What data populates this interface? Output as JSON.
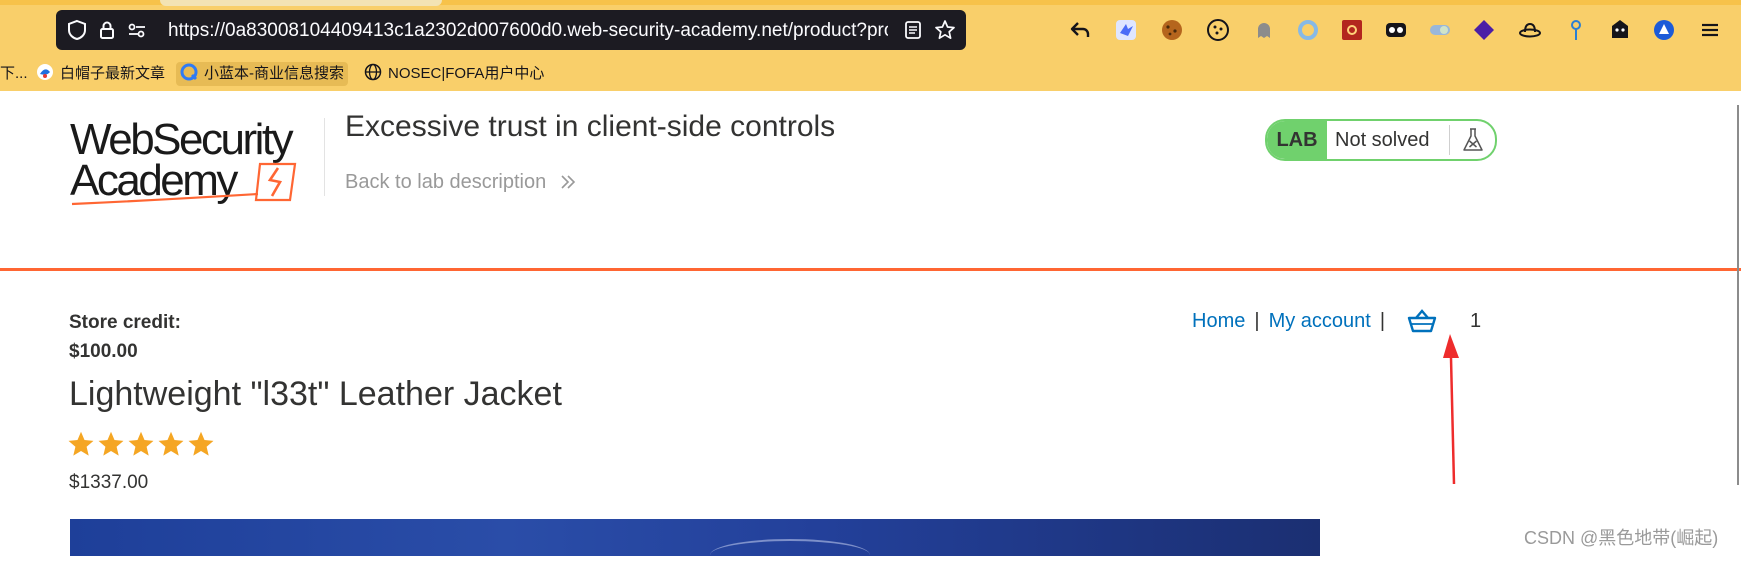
{
  "browser": {
    "url": "https://0a83008104409413c1a2302d007600d0.web-security-academy.net/product?prod",
    "bookmarks": [
      {
        "label": "下...",
        "icon": "folder-icon"
      },
      {
        "label": "白帽子最新文章",
        "icon": "bird-icon"
      },
      {
        "label": "小蓝本-商业信息搜索",
        "icon": "q-logo-icon"
      },
      {
        "label": "NOSEC|FOFA用户中心",
        "icon": "globe-icon"
      }
    ],
    "toolbar_icons": [
      "back-arrow-icon",
      "extension-bird-icon",
      "cookie-icon",
      "cookie-editor-icon",
      "ghost-icon",
      "ring-icon",
      "settings-box-icon",
      "glasses-icon",
      "toggle-icon",
      "diamond-icon",
      "hat-icon",
      "pin-icon",
      "robot-icon",
      "triangle-icon",
      "menu-icon"
    ]
  },
  "lab": {
    "logo_line1": "WebSecurity",
    "logo_line2": "Academy",
    "title": "Excessive trust in client-side controls",
    "back_link": "Back to lab description",
    "badge_label": "LAB",
    "status": "Not solved"
  },
  "store": {
    "credit_label": "Store credit:",
    "credit_value": "$100.00",
    "nav": {
      "home": "Home",
      "sep1": "|",
      "account": "My account",
      "sep2": "|"
    },
    "cart_count": "1"
  },
  "product": {
    "name": "Lightweight \"l33t\" Leather Jacket",
    "rating": 5,
    "price": "$1337.00"
  },
  "watermark": "CSDN @黑色地带(崛起)",
  "colors": {
    "accent_orange": "#ff6633",
    "lab_green": "#70d16d",
    "link_blue": "#0071bc",
    "star_orange": "#f5a623",
    "annotation_red": "#ee2c2c"
  }
}
